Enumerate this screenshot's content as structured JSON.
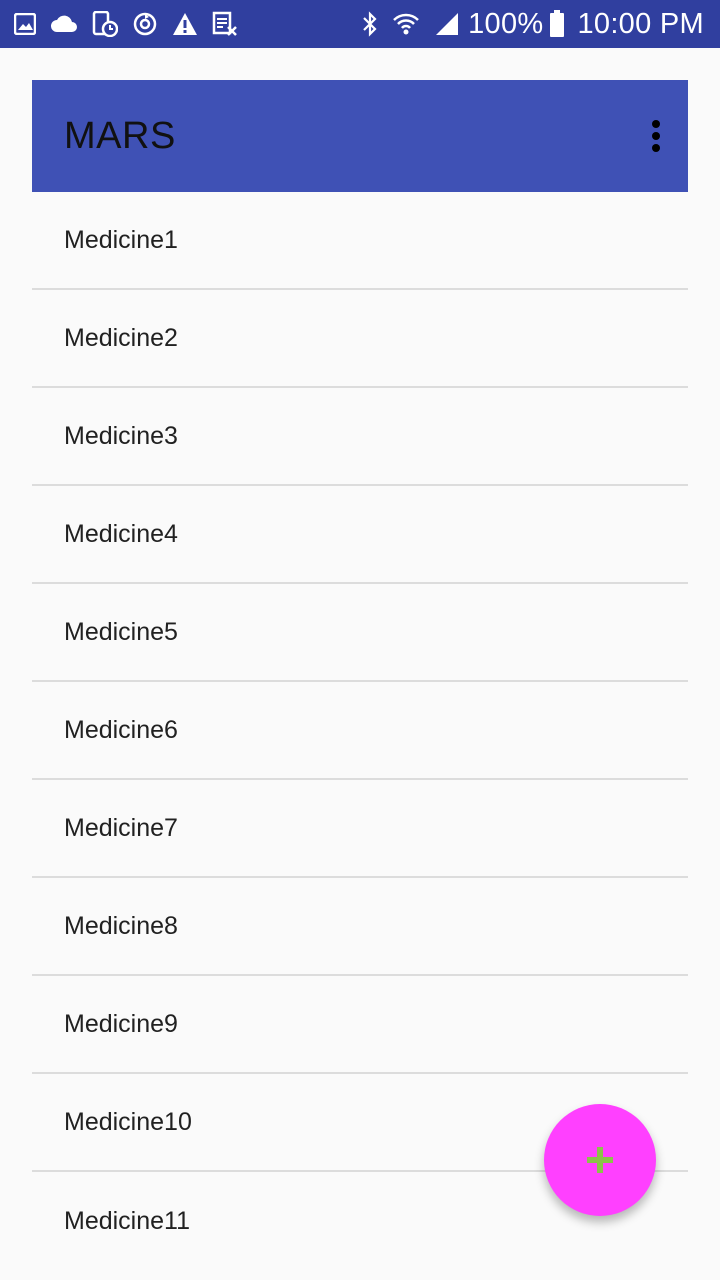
{
  "status_bar": {
    "left_icons": [
      "gallery-icon",
      "cloud-icon",
      "device-schedule-icon",
      "sync-icon",
      "warning-icon",
      "calendar-x-icon"
    ],
    "right_icons": [
      "bluetooth-icon",
      "wifi-icon",
      "signal-icon",
      "battery-icon"
    ],
    "battery_text": "100%",
    "time": "10:00 PM"
  },
  "app_bar": {
    "title": "MARS",
    "menu_icon": "more-vert-icon"
  },
  "list": {
    "items": [
      {
        "label": "Medicine1"
      },
      {
        "label": "Medicine2"
      },
      {
        "label": "Medicine3"
      },
      {
        "label": "Medicine4"
      },
      {
        "label": "Medicine5"
      },
      {
        "label": "Medicine6"
      },
      {
        "label": "Medicine7"
      },
      {
        "label": "Medicine8"
      },
      {
        "label": "Medicine9"
      },
      {
        "label": "Medicine10"
      },
      {
        "label": "Medicine11"
      }
    ]
  },
  "fab": {
    "icon": "plus-icon",
    "background_color": "#ff40ff",
    "icon_color": "#8bc34a"
  },
  "colors": {
    "status_bar": "#303f9f",
    "app_bar": "#3f51b5",
    "background": "#fafafa",
    "divider": "#dcdcdc"
  }
}
